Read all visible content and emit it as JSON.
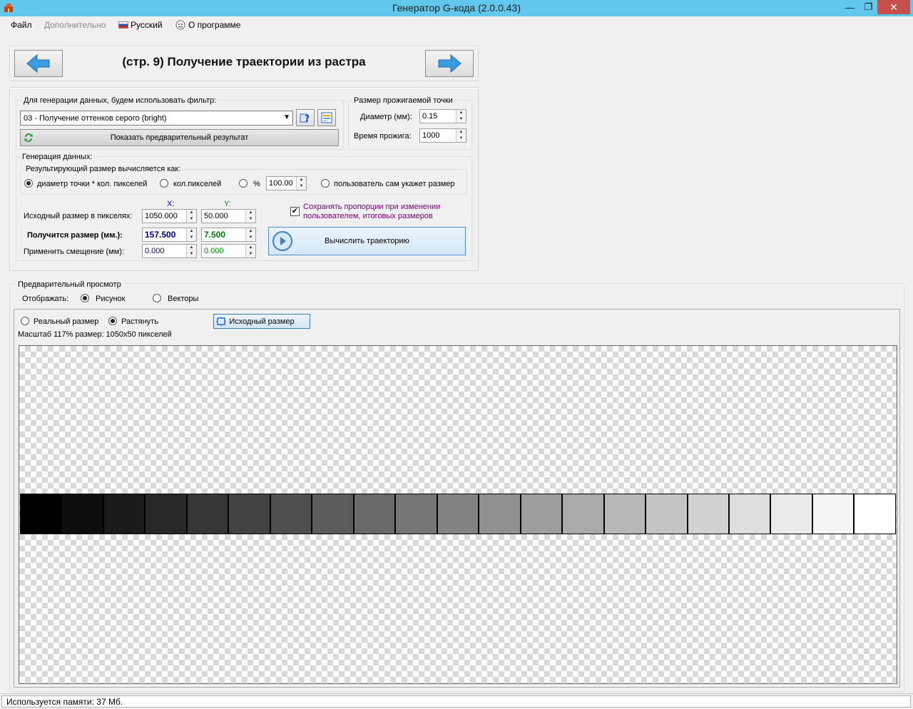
{
  "window": {
    "title": "Генератор G-кода (2.0.0.43)",
    "min_symbol": "—",
    "max_symbol": "❐",
    "close_symbol": "✕"
  },
  "menu": {
    "file": "Файл",
    "extra": "Дополнительно",
    "language": "Русский",
    "about": "О программе"
  },
  "header": {
    "title": "(стр. 9) Получение траектории из растра"
  },
  "filter": {
    "label": "Для генерации данных, будем использовать фильтр:",
    "selected": "03 - Получение оттенков серого (bright)",
    "preview_button": "Показать предварительный результат"
  },
  "burn": {
    "title": "Размер прожигаемой точки",
    "diameter_label": "Диаметр (мм):",
    "diameter_value": "0.15",
    "burn_time_label": "Время прожига:",
    "burn_time_value": "1000"
  },
  "generation": {
    "title": "Генерация данных:",
    "result_size_title": "Результирующий размер вычисляется как:",
    "options": [
      {
        "label": "диаметр точки * кол.  пикселей",
        "selected": true
      },
      {
        "label": "кол.пикселей",
        "selected": false
      },
      {
        "label": "%",
        "selected": false
      },
      {
        "label": "пользователь сам укажет размер",
        "selected": false
      }
    ],
    "percent_value": "100.00",
    "x_header": "X:",
    "y_header": "Y:",
    "source_label": "Исходный размер в пикселях:",
    "source_x": "1050.000",
    "source_y": "50.000",
    "result_label": "Получится размер (мм.):",
    "result_x": "157.500",
    "result_y": "7.500",
    "offset_label": "Применить смещение (мм):",
    "offset_x": "0.000",
    "offset_y": "0.000",
    "keep_proportions": "Сохранять пропорции при изменении пользователем, итоговых размеров",
    "keep_proportions_checked": true,
    "calc_button": "Вычислить траекторию"
  },
  "preview": {
    "title": "Предварительный просмотр",
    "display_label": "Отображать:",
    "display_options": [
      {
        "label": "Рисунок",
        "selected": true
      },
      {
        "label": "Векторы",
        "selected": false
      }
    ],
    "size_options": [
      {
        "label": "Реальный размер",
        "selected": false
      },
      {
        "label": "Растянуть",
        "selected": true
      }
    ],
    "original_size_button": "Исходный размер",
    "scale_info": "Масштаб 117% размер: 1050x50 пикселей",
    "swatches": [
      "#000000",
      "#0e0e0e",
      "#1b1b1b",
      "#282828",
      "#353535",
      "#424242",
      "#4f4f4f",
      "#5c5c5c",
      "#696969",
      "#767676",
      "#838383",
      "#909090",
      "#9d9d9d",
      "#aaaaaa",
      "#b7b7b7",
      "#c4c4c4",
      "#d1d1d1",
      "#dedede",
      "#ebebeb",
      "#f5f5f5",
      "#ffffff"
    ]
  },
  "status": {
    "memory": "Используется памяти:  37  Мб."
  },
  "colors": {
    "titlebar": "#61c7ed",
    "close_button": "#c7504a",
    "x_value": "#00008b",
    "y_value": "#008000",
    "x_header": "#0000cc",
    "y_header": "#008000",
    "checkbox_text": "#800080"
  }
}
